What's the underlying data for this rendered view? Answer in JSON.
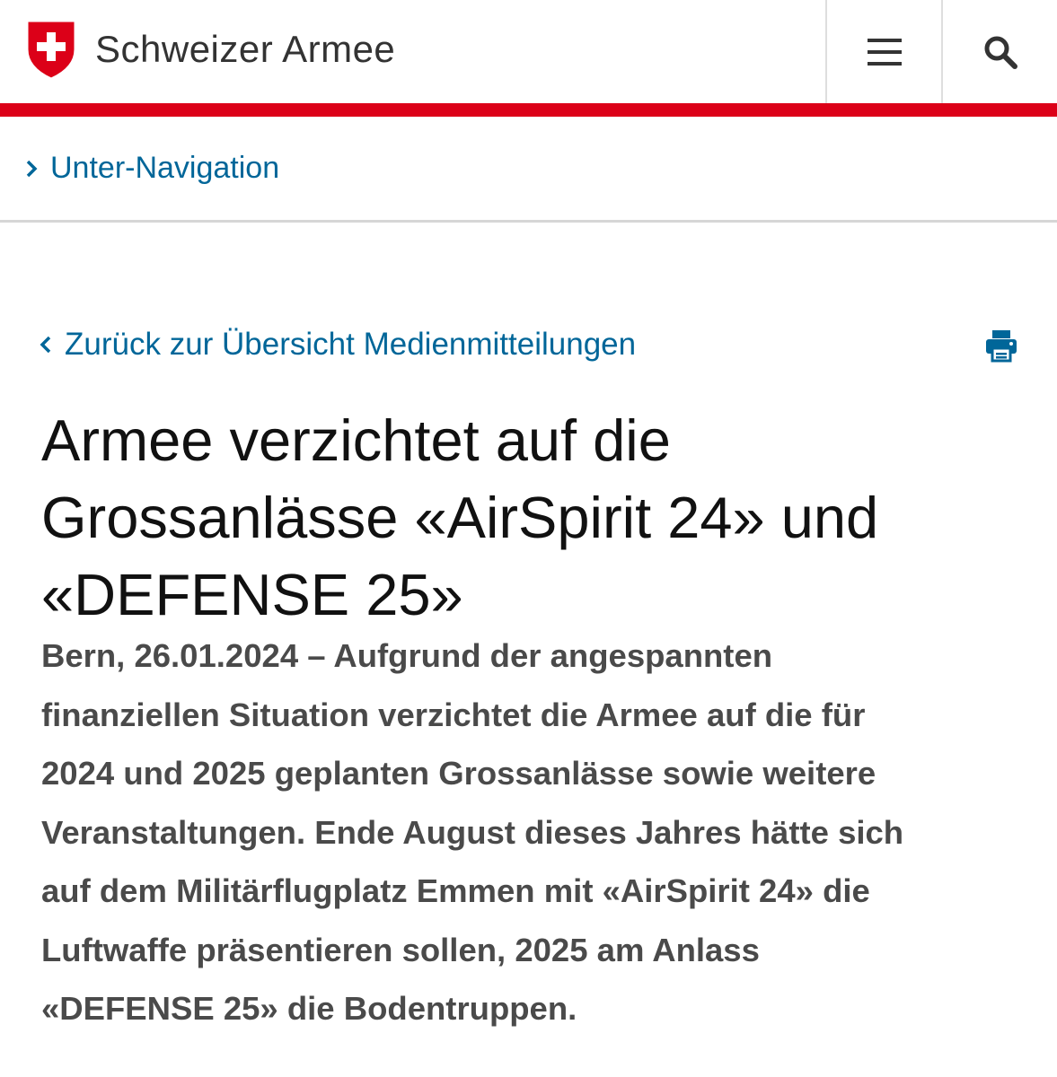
{
  "header": {
    "site_name": "Schweizer Armee",
    "logo_icon": "swiss-shield-icon",
    "menu_icon": "hamburger-menu-icon",
    "search_icon": "search-icon",
    "accent_color": "#dc0018"
  },
  "subnav": {
    "label": "Unter-Navigation",
    "icon": "chevron-right-icon"
  },
  "article": {
    "back_link": "Zurück zur Übersicht Medienmitteilungen",
    "back_icon": "chevron-left-icon",
    "print_icon": "printer-icon",
    "title_lines": [
      "Armee verzichtet auf die",
      "Grossanlässe «AirSpirit 24» und",
      "«DEFENSE 25»"
    ],
    "lead_lines": [
      "Bern, 26.01.2024 – Aufgrund der angespannten",
      "finanziellen Situation verzichtet die Armee auf die für",
      "2024 und 2025 geplanten Grossanlässe sowie weitere",
      "Veranstaltungen. Ende August dieses Jahres hätte sich",
      "auf dem Militärflugplatz Emmen mit «AirSpirit 24» die",
      "Luftwaffe präsentieren sollen, 2025 am Anlass",
      "«DEFENSE 25» die Bodentruppen."
    ],
    "link_color": "#006699"
  }
}
